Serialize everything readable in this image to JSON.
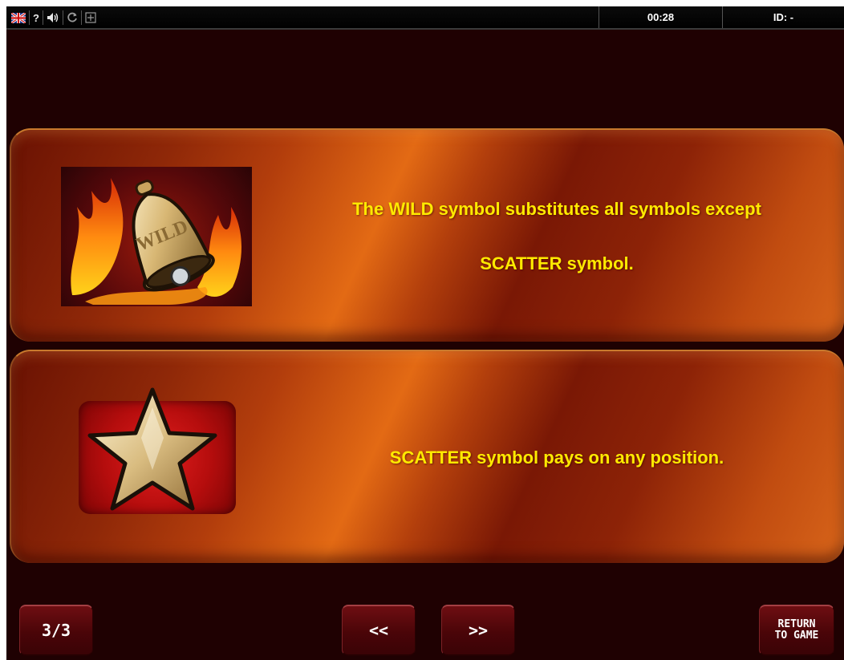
{
  "top_bar": {
    "icons": [
      "uk-flag-icon",
      "help-icon",
      "sound-icon",
      "refresh-icon",
      "fullscreen-icon"
    ],
    "help_glyph": "?",
    "time": "00:28",
    "id_text": "ID: -"
  },
  "panels": [
    {
      "symbol": "wild-bell-icon",
      "symbol_label": "WILD",
      "line1": "The WILD symbol substitutes all symbols except",
      "line2": "SCATTER symbol."
    },
    {
      "symbol": "scatter-star-icon",
      "line1": "SCATTER symbol pays on any position."
    }
  ],
  "buttons": {
    "page": "3/3",
    "prev": "<<",
    "next": ">>",
    "return_line1": "RETURN",
    "return_line2": "TO GAME"
  },
  "colors": {
    "background": "#1f0102",
    "panel_highlight": "#e36a14",
    "text_yellow": "#ffea00",
    "button_red": "#4a0508"
  }
}
